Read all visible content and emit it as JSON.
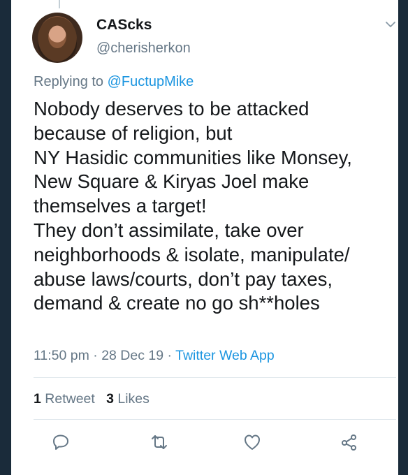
{
  "tweet": {
    "display_name": "CAScks",
    "handle": "@cherisherkon",
    "replying_prefix": "Replying to",
    "replying_to": "@FuctupMike",
    "text_lines": [
      "Nobody deserves to be attacked",
      "because of religion, but",
      "NY Hasidic communities like Monsey,",
      "New Square & Kiryas Joel make",
      "themselves a target!",
      "They don’t assimilate, take over",
      "neighborhoods & isolate, manipulate/",
      "abuse laws/courts, don’t pay taxes,",
      "demand & create no go sh**holes"
    ],
    "time": "11:50 pm",
    "date": "28 Dec 19",
    "source": "Twitter Web App",
    "separator": "·",
    "retweet_count": "1",
    "retweet_label": "Retweet",
    "like_count": "3",
    "like_label": "Likes"
  },
  "icons": {
    "menu": "chevron-down-icon",
    "reply": "reply-icon",
    "retweet": "retweet-icon",
    "like": "heart-icon",
    "share": "share-icon"
  },
  "colors": {
    "text": "#14171a",
    "secondary": "#657786",
    "link": "#1b95e0",
    "border": "#e1e8ed",
    "background_frame": "#1a2b3a"
  }
}
